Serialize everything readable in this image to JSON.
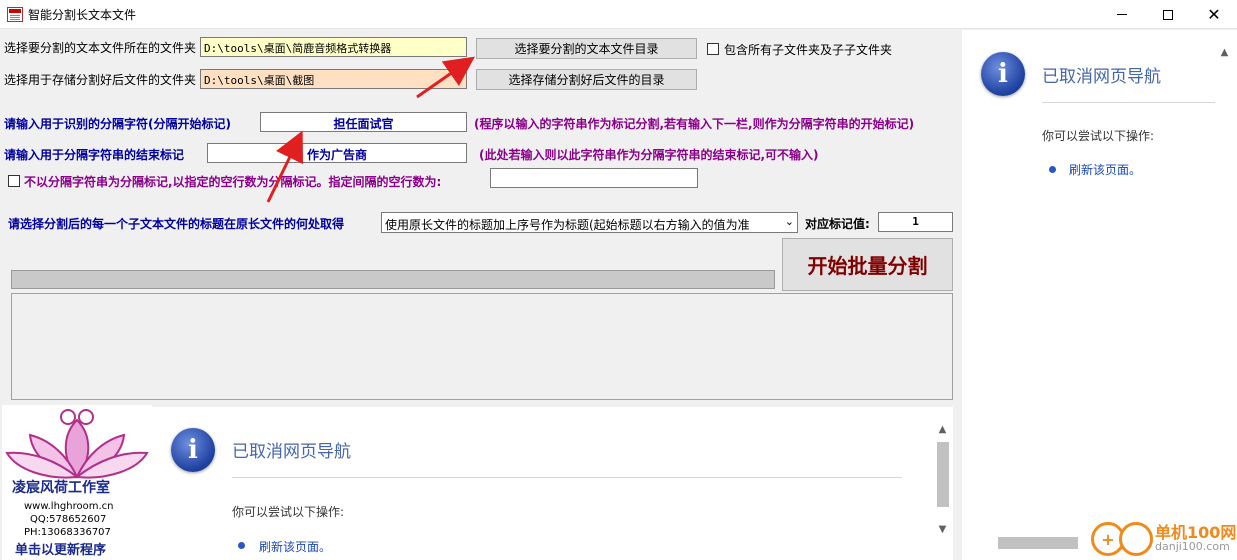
{
  "window": {
    "title": "智能分割长文本文件"
  },
  "folders": {
    "source_label": "选择要分割的文本文件所在的文件夹",
    "source_value": "D:\\tools\\桌面\\简鹿音频格式转换器",
    "source_button": "选择要分割的文本文件目录",
    "subfolders_label": "包含所有子文件夹及子子文件夹",
    "target_label": "选择用于存储分割好后文件的文件夹",
    "target_value": "D:\\tools\\桌面\\截图",
    "target_button": "选择存储分割好后文件的目录"
  },
  "separator": {
    "start_label": "请输入用于识别的分隔字符(分隔开始标记)",
    "start_value": "担任面试官",
    "start_hint": "(程序以输入的字符串作为标记分割,若有输入下一栏,则作为分隔字符串的开始标记)",
    "end_label": "请输入用于分隔字符串的结束标记",
    "end_value": "作为广告商",
    "end_hint": "(此处若输入则以此字符串作为分隔字符串的结束标记,可不输入)",
    "blank_lines_label": "不以分隔字符串为分隔标记,以指定的空行数为分隔标记。指定间隔的空行数为:",
    "blank_lines_value": ""
  },
  "title_source": {
    "label": "请选择分割后的每一个子文本文件的标题在原长文件的何处取得",
    "selected": "使用原长文件的标题加上序号作为标题(起始标题以右方输入的值为准",
    "mark_label": "对应标记值:",
    "mark_value": "1"
  },
  "actions": {
    "start_label": "开始批量分割"
  },
  "browser_right": {
    "icon": "info-icon",
    "title": "已取消网页导航",
    "subtitle": "你可以尝试以下操作:",
    "link": "刷新该页面。"
  },
  "browser_bottom": {
    "icon": "info-icon",
    "title": "已取消网页导航",
    "subtitle": "你可以尝试以下操作:",
    "link": "刷新该页面。"
  },
  "logo": {
    "brand": "凌宸风荷工作室",
    "url": "www.lhghroom.cn",
    "qq": "QQ:578652607",
    "phone": "PH:13068336707",
    "update": "单击以更新程序"
  },
  "watermark": {
    "name": "单机100网",
    "url": "danji100.com"
  },
  "colors": {
    "folder_source_bg": "#ffffc8",
    "folder_target_bg": "#ffe0c2",
    "label_purple": "#8b008b",
    "label_blue": "#0000a0",
    "start_text": "#800000",
    "nav_title": "#4466aa"
  }
}
